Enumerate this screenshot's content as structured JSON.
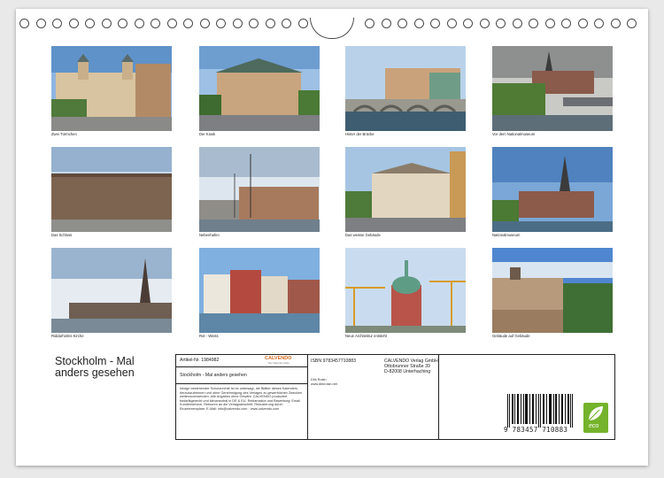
{
  "photos": [
    {
      "caption": "Zwei Türmchen"
    },
    {
      "caption": "Der Kiosk"
    },
    {
      "caption": "Hinter der Brücke"
    },
    {
      "caption": "Vor dem Nationalmuseum"
    },
    {
      "caption": "Das Schloss"
    },
    {
      "caption": "Nebenhafen"
    },
    {
      "caption": "Das weisse Gebäude"
    },
    {
      "caption": "Nationalmuseum"
    },
    {
      "caption": "Riddarholms Kirche"
    },
    {
      "caption": "Rot - Weiss"
    },
    {
      "caption": "Neue Architektur entsteht"
    },
    {
      "caption": "Gebäude auf Gebäude"
    }
  ],
  "title_line1": "Stockholm - Mal",
  "title_line2": "anders gesehen",
  "info": {
    "article": "Artikel-Nr. 1984982",
    "publisher_logo": "CALVENDO",
    "publisher_tagline": "Die Kalendermarke",
    "book_title": "Stockholm - Mal anders gesehen",
    "legal": "Infolge bestehender Schutzrechte ist es untersagt, die Blätter dieses Kalenders herauszutrennen und ohne Genehmigung des Verlages zu gewerblichen Zwecken weiterzuverwenden. Alle Angaben ohne Gewähr. CALVENDO produziert bedarfsgerecht und klimaneutral in DE & EU. Reklamation und Bewertung: Email Kundenservice, Retouren an die Verlagsanschrift, Reduzierung durch Einzelexemplare. E-Mail: info@calvendo.com · www.calvendo.com",
    "isbn": "ISBN 9783457710883",
    "author": "Dirk Rosin",
    "author_web": "www.dirkrosin.net",
    "verlag1": "CALVENDO Verlag GmbH",
    "verlag2": "Ottobrunner Straße 39",
    "verlag3": "D-82008 Unterhaching",
    "barcode_digits": "9 783457 710883",
    "eco_label": "eco"
  }
}
